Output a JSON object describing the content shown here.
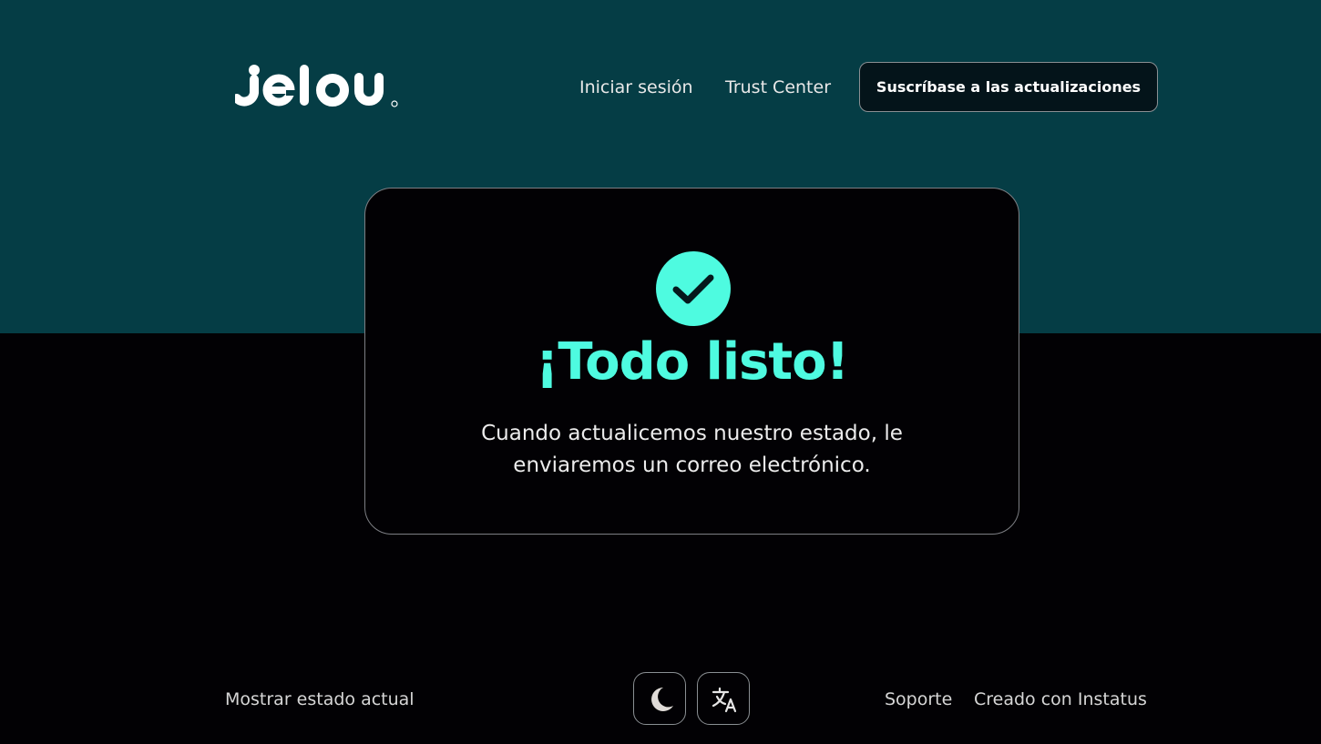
{
  "header": {
    "logo_text": "Jelou",
    "nav": {
      "login": "Iniciar sesión",
      "trust_center": "Trust Center"
    },
    "subscribe_label": "Suscríbase a las actualizaciones"
  },
  "card": {
    "icon": "check-icon",
    "title": "¡Todo listo!",
    "message": "Cuando actualicemos nuestro estado, le enviaremos un correo electrónico."
  },
  "footer": {
    "current_status": "Mostrar estado actual",
    "theme_toggle_icon": "moon-icon",
    "language_icon": "translate-icon",
    "support": "Soporte",
    "made_with": "Creado con Instatus"
  },
  "colors": {
    "header_bg": "#053d45",
    "page_bg": "#020104",
    "accent": "#4efbe0"
  }
}
